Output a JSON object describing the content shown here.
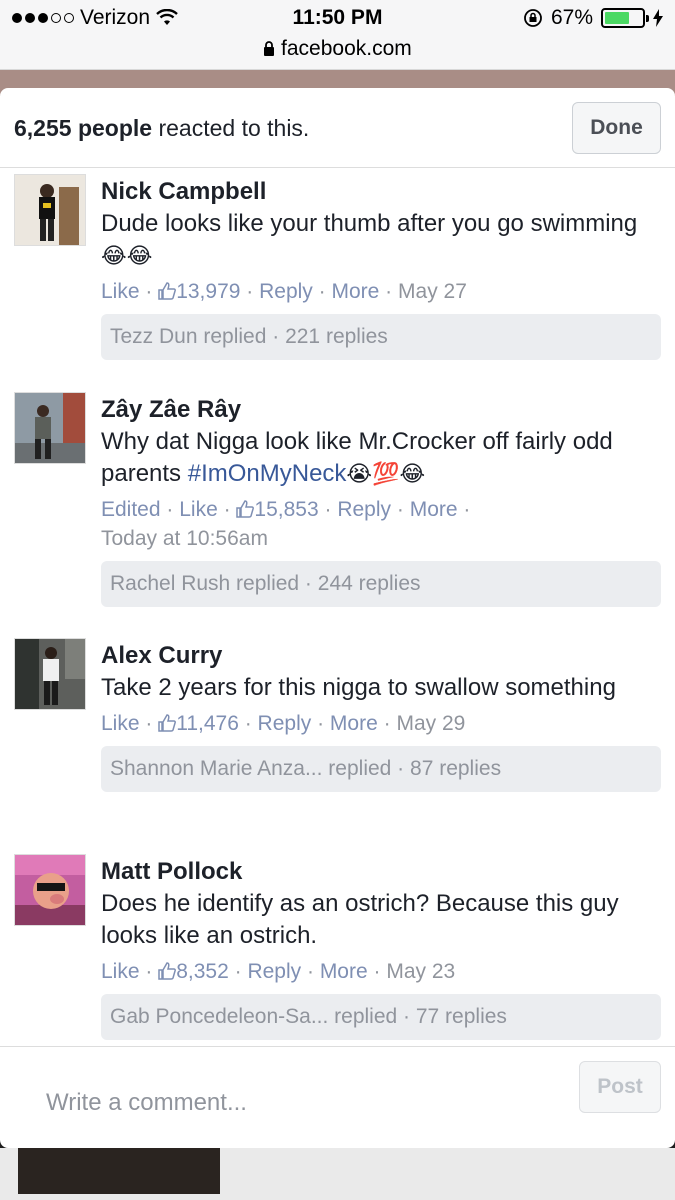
{
  "status_bar": {
    "carrier": "Verizon",
    "time": "11:50 PM",
    "battery": "67%",
    "battery_level": 0.67,
    "url": "facebook.com",
    "icons": [
      "signal-dots-icon",
      "wifi-icon",
      "orientation-lock-icon",
      "battery-icon",
      "charging-icon",
      "lock-icon"
    ]
  },
  "header": {
    "count": "6,255 people",
    "suffix": " reacted to this.",
    "done_label": "Done"
  },
  "comments": [
    {
      "name": "Nick Campbell",
      "text": "Dude looks like your thumb after you go swimming",
      "emoji": "😂😂",
      "edited": "",
      "like": "Like",
      "likes": "13,979",
      "reply": "Reply",
      "more": "More",
      "date": "May 27",
      "replies": "Tezz Dun replied · 221 replies"
    },
    {
      "name": "Zây Zâe Rây",
      "text": "Why dat Nigga look like Mr.Crocker off fairly odd parents ",
      "hashtag": "#ImOnMyNeck",
      "emoji": "😭💯😂",
      "edited": "Edited",
      "like": "Like",
      "likes": "15,853",
      "reply": "Reply",
      "more": "More",
      "date": "Today at 10:56am",
      "replies": "Rachel Rush replied · 244 replies"
    },
    {
      "name": "Alex Curry",
      "text": "Take 2 years for this nigga to swallow something",
      "like": "Like",
      "likes": "11,476",
      "reply": "Reply",
      "more": "More",
      "date": "May 29",
      "replies": "Shannon Marie Anza... replied · 87 replies"
    },
    {
      "name": "Matt Pollock",
      "text": "Does he identify as an ostrich? Because this guy looks like an ostrich.",
      "like": "Like",
      "likes": "8,352",
      "reply": "Reply",
      "more": "More",
      "date": "May 23",
      "replies": "Gab Poncedeleon-Sa... replied · 77 replies"
    }
  ],
  "composer": {
    "placeholder": "Write a comment...",
    "post_label": "Post"
  },
  "colors": {
    "link": "#7f8fb3",
    "hashtag": "#385898",
    "battery": "#4cd964"
  }
}
